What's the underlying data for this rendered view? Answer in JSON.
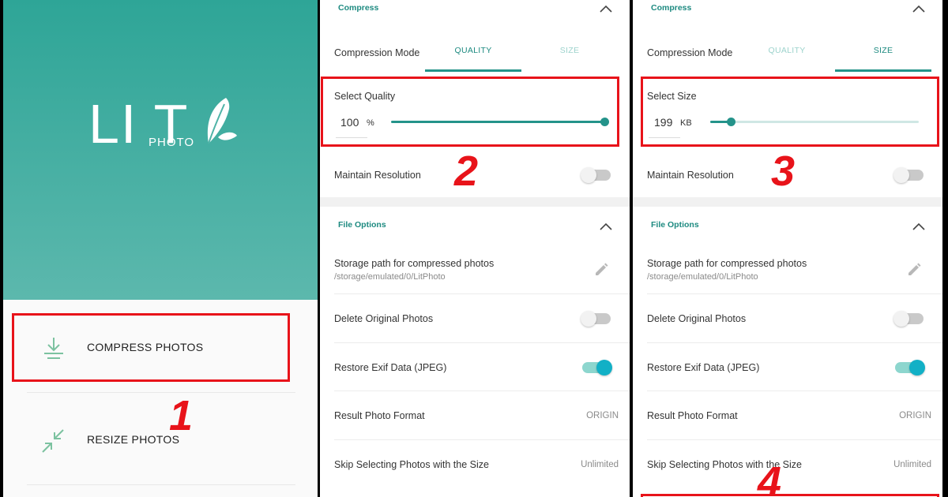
{
  "home": {
    "logo_main": "LI T",
    "logo_sub": "PHOTO",
    "menu": [
      {
        "label": "COMPRESS PHOTOS",
        "icon": "download-icon"
      },
      {
        "label": "RESIZE PHOTOS",
        "icon": "shrink-arrows-icon"
      }
    ]
  },
  "compress_section": {
    "title": "Compress",
    "mode_label": "Compression Mode",
    "tabs": [
      "QUALITY",
      "SIZE"
    ]
  },
  "quality_panel": {
    "active_tab": "QUALITY",
    "select_label": "Select Quality",
    "value": "100",
    "unit": "%",
    "slider_level": 1.0
  },
  "size_panel": {
    "active_tab": "SIZE",
    "select_label": "Select Size",
    "value": "199",
    "unit": "KB",
    "slider_level": 0.1
  },
  "maintain_resolution": {
    "label": "Maintain Resolution",
    "on": false
  },
  "file_options": {
    "title": "File Options",
    "storage_label": "Storage path for compressed photos",
    "storage_path": "/storage/emulated/0/LitPhoto",
    "delete_original": {
      "label": "Delete Original Photos",
      "on": false
    },
    "restore_exif": {
      "label": "Restore Exif Data (JPEG)",
      "on": true
    },
    "result_format": {
      "label": "Result Photo Format",
      "value": "ORIGIN"
    },
    "skip_size": {
      "label": "Skip Selecting Photos with the Size",
      "value": "Unlimited"
    }
  },
  "step_numbers": [
    "1",
    "2",
    "3",
    "4"
  ],
  "colors": {
    "brand_teal": "#2ea597",
    "accent_red": "#e8131a",
    "toggle_on": "#12b0c6"
  }
}
